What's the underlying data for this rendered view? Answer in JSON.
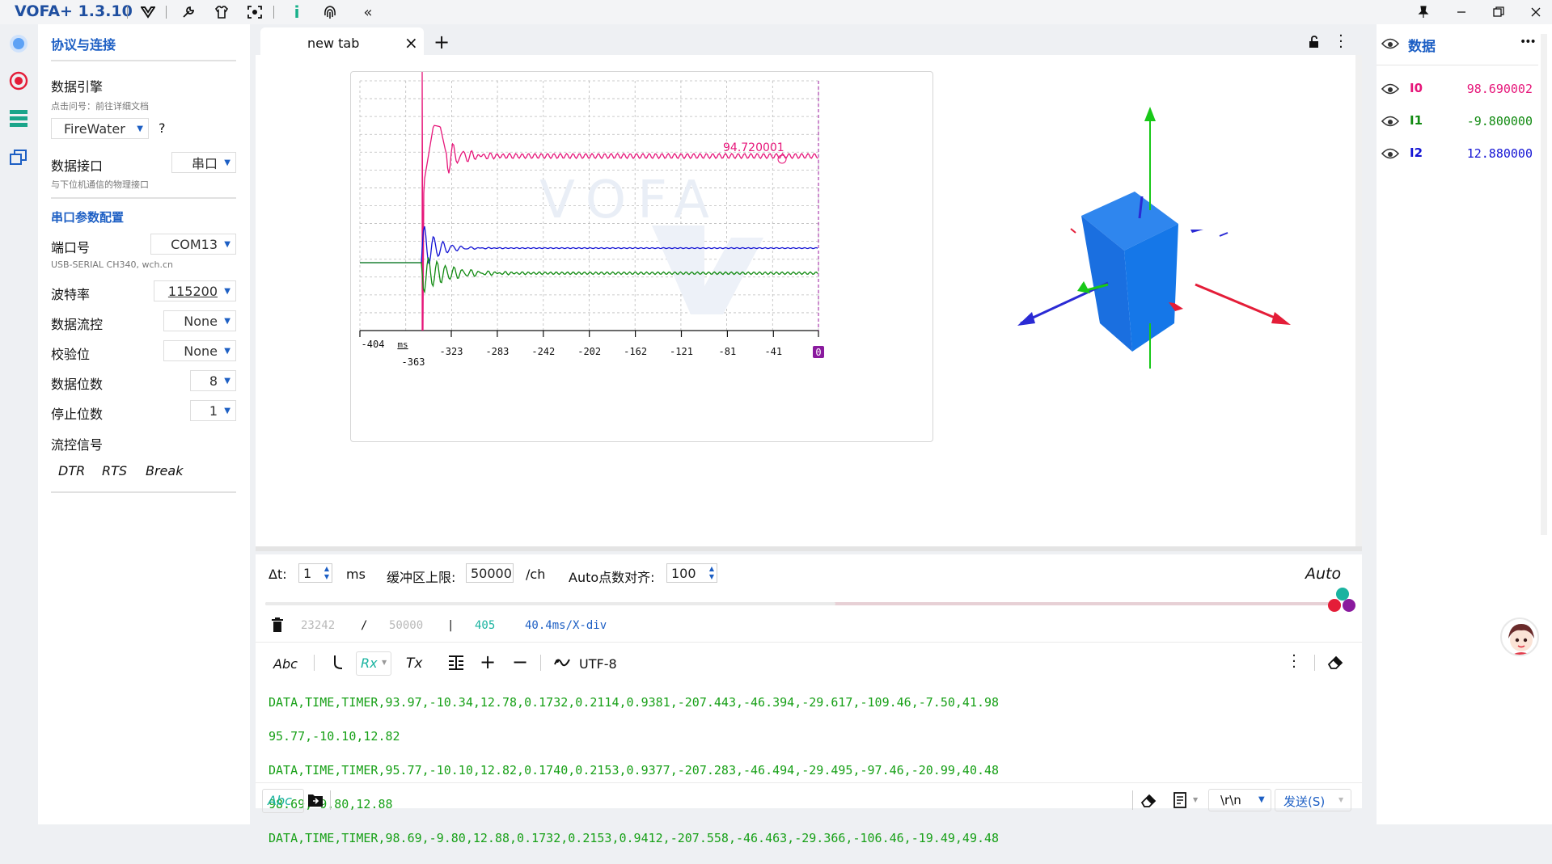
{
  "app": {
    "title": "VOFA+ 1.3.10",
    "toolbar_icons": [
      "vofa-logo-icon",
      "wrench-icon",
      "shirt-icon",
      "capture-icon",
      "info-icon",
      "fingerprint-icon",
      "collapse-icon"
    ],
    "window_controls": [
      "pin-icon",
      "minimize-icon",
      "maximize-icon",
      "close-icon"
    ]
  },
  "sidebar_icons": [
    "connection-icon",
    "record-icon",
    "data-list-icon",
    "windows-icon"
  ],
  "left": {
    "section_title": "协议与连接",
    "engine_label": "数据引擎",
    "engine_hint": "点击问号：前往详细文档",
    "engine_value": "FireWater",
    "help_mark": "?",
    "interface_label": "数据接口",
    "interface_value": "串口",
    "interface_hint": "与下位机通信的物理接口",
    "serial_title": "串口参数配置",
    "port_label": "端口号",
    "port_value": "COM13",
    "port_desc": "USB-SERIAL CH340, wch.cn",
    "baud_label": "波特率",
    "baud_value": "115200",
    "flow_label": "数据流控",
    "flow_value": "None",
    "parity_label": "校验位",
    "parity_value": "None",
    "databits_label": "数据位数",
    "databits_value": "8",
    "stopbits_label": "停止位数",
    "stopbits_value": "1",
    "signal_label": "流控信号",
    "signals": [
      "DTR",
      "RTS",
      "Break"
    ]
  },
  "tab": {
    "label": "new tab",
    "close": "×",
    "add": "+"
  },
  "chart_data": {
    "type": "line",
    "x_ticks": [
      "-404",
      "-363",
      "-323",
      "-283",
      "-242",
      "-202",
      "-162",
      "-121",
      "-81",
      "-41",
      "0"
    ],
    "x_unit": "ms",
    "watermark": "VOFA",
    "annotation": "94.720001",
    "grid": true,
    "series": [
      {
        "color": "#e6177a",
        "steady_value": 94.72
      },
      {
        "color": "#1414d4",
        "steady_value": 12.88
      },
      {
        "color": "#118a11",
        "steady_value": -9.8
      }
    ]
  },
  "controls": {
    "dt_label": "Δt:",
    "dt_value": "1",
    "dt_unit": "ms",
    "buffer_label": "缓冲区上限:",
    "buffer_value": "50000",
    "buffer_unit": "/ch",
    "align_label": "Auto点数对齐:",
    "align_value": "100",
    "auto_label": "Auto",
    "slider_fraction": 0.53
  },
  "stats": {
    "count": "23242",
    "slash": "/",
    "limit": "50000",
    "bar": "|",
    "points": "405",
    "div": "40.4ms/X-div"
  },
  "rx_toolbar": {
    "abc": "Abc",
    "rx": "Rx",
    "tx": "Tx",
    "encoding": "UTF-8"
  },
  "log_lines": [
    "DATA,TIME,TIMER,93.97,-10.34,12.78,0.1732,0.2114,0.9381,-207.443,-46.394,-29.617,-109.46,-7.50,41.98",
    "95.77,-10.10,12.82",
    "DATA,TIME,TIMER,95.77,-10.10,12.82,0.1740,0.2153,0.9377,-207.283,-46.494,-29.495,-97.46,-20.99,40.48",
    "98.69,-9.80,12.88",
    "DATA,TIME,TIMER,98.69,-9.80,12.88,0.1732,0.2153,0.9412,-207.558,-46.463,-29.366,-106.46,-19.49,49.48"
  ],
  "send_bar": {
    "abc": "Abc",
    "line_ending": "\\r\\n",
    "send_label": "发送(S)"
  },
  "right": {
    "title": "数据",
    "more": "•••",
    "channels": [
      {
        "name": "I0",
        "value": "98.690002",
        "color": "#e6177a"
      },
      {
        "name": "I1",
        "value": "-9.800000",
        "color": "#118a11"
      },
      {
        "name": "I2",
        "value": "12.880000",
        "color": "#1414d4"
      }
    ]
  }
}
